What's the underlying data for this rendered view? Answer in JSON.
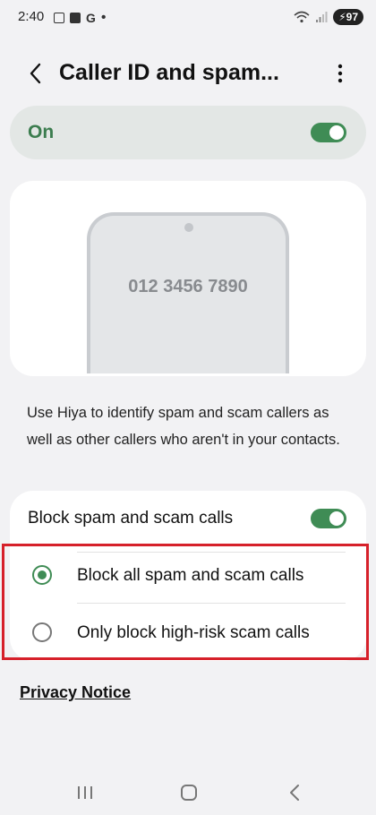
{
  "status_bar": {
    "time": "2:40",
    "notification_icons": [
      "screenshot-icon",
      "checkbox-icon",
      "google-icon",
      "dot-icon"
    ],
    "google_letter": "G",
    "battery": "97"
  },
  "app_bar": {
    "title": "Caller ID and spam..."
  },
  "master_switch": {
    "label": "On",
    "state": true
  },
  "illustration": {
    "phone_number": "012 3456 7890"
  },
  "description": "Use Hiya to identify spam and scam callers as well as other callers who aren't in your contacts.",
  "block_settings": {
    "title": "Block spam and scam calls",
    "toggle_state": true,
    "options": [
      {
        "label": "Block all spam and scam calls",
        "selected": true
      },
      {
        "label": "Only block high-risk scam calls",
        "selected": false
      }
    ]
  },
  "privacy_link": "Privacy Notice",
  "colors": {
    "accent": "#3f8c55",
    "highlight_border": "#d6202a",
    "background": "#f2f2f4"
  }
}
